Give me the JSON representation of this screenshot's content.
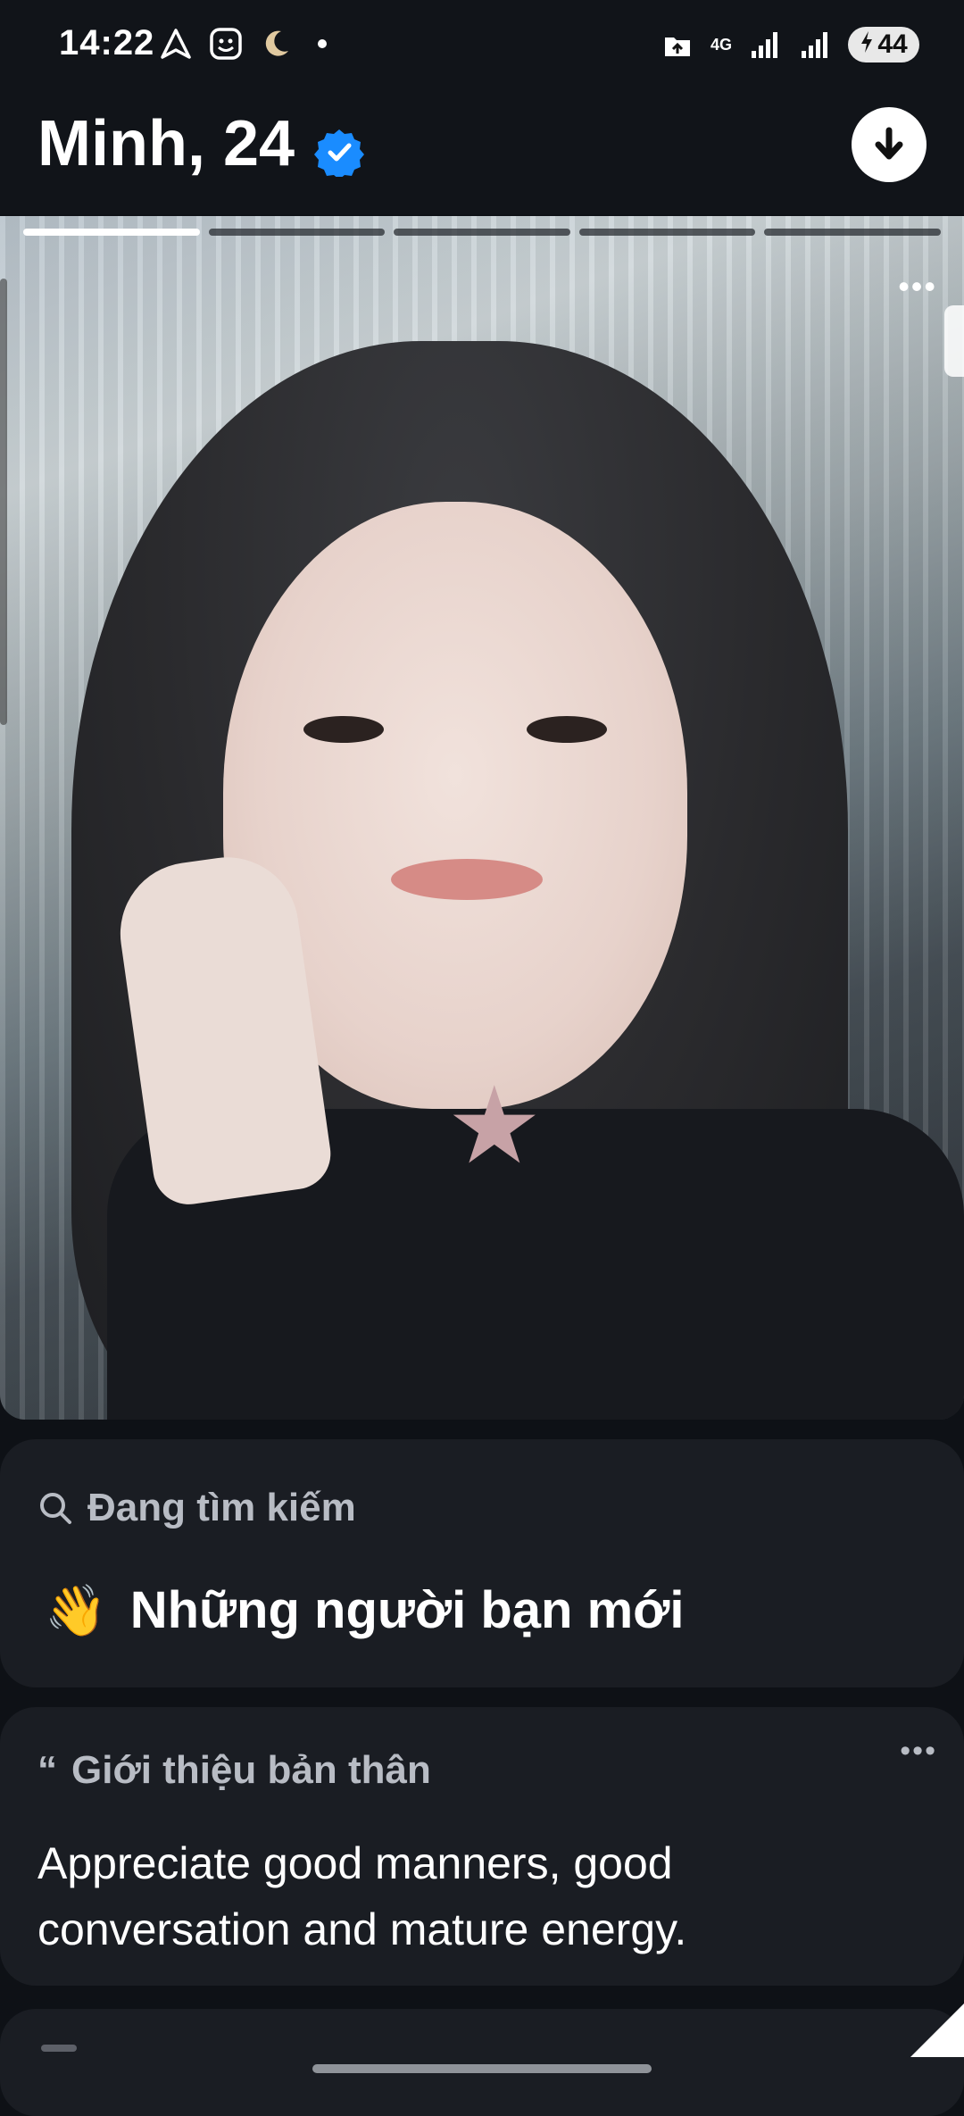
{
  "status_bar": {
    "time": "14:22",
    "network_label": "4G",
    "battery": "44",
    "left_icons": [
      "navigation-icon",
      "face-app-icon",
      "moon-icon",
      "notification-dot"
    ],
    "right_icons": [
      "upload-icon",
      "signal-icon",
      "signal-icon-2",
      "battery-icon"
    ]
  },
  "header": {
    "name_age": "Minh, 24",
    "verified": true,
    "download_icon": "arrow-down-icon"
  },
  "photo": {
    "progress_segments": 5,
    "active_segment": 1,
    "more_label": "•••"
  },
  "looking_for": {
    "label": "Đang tìm kiếm",
    "emoji": "👋",
    "value": "Những người bạn mới"
  },
  "about": {
    "label": "Giới thiệu bản thân",
    "quote_mark": "“",
    "text": "Appreciate good manners, good conversation and mature energy.",
    "more_label": "•••"
  },
  "colors": {
    "background": "#0e1116",
    "card": "#1a1d23",
    "verified_badge": "#1a8cff",
    "label_gray": "#b8bcc4"
  }
}
